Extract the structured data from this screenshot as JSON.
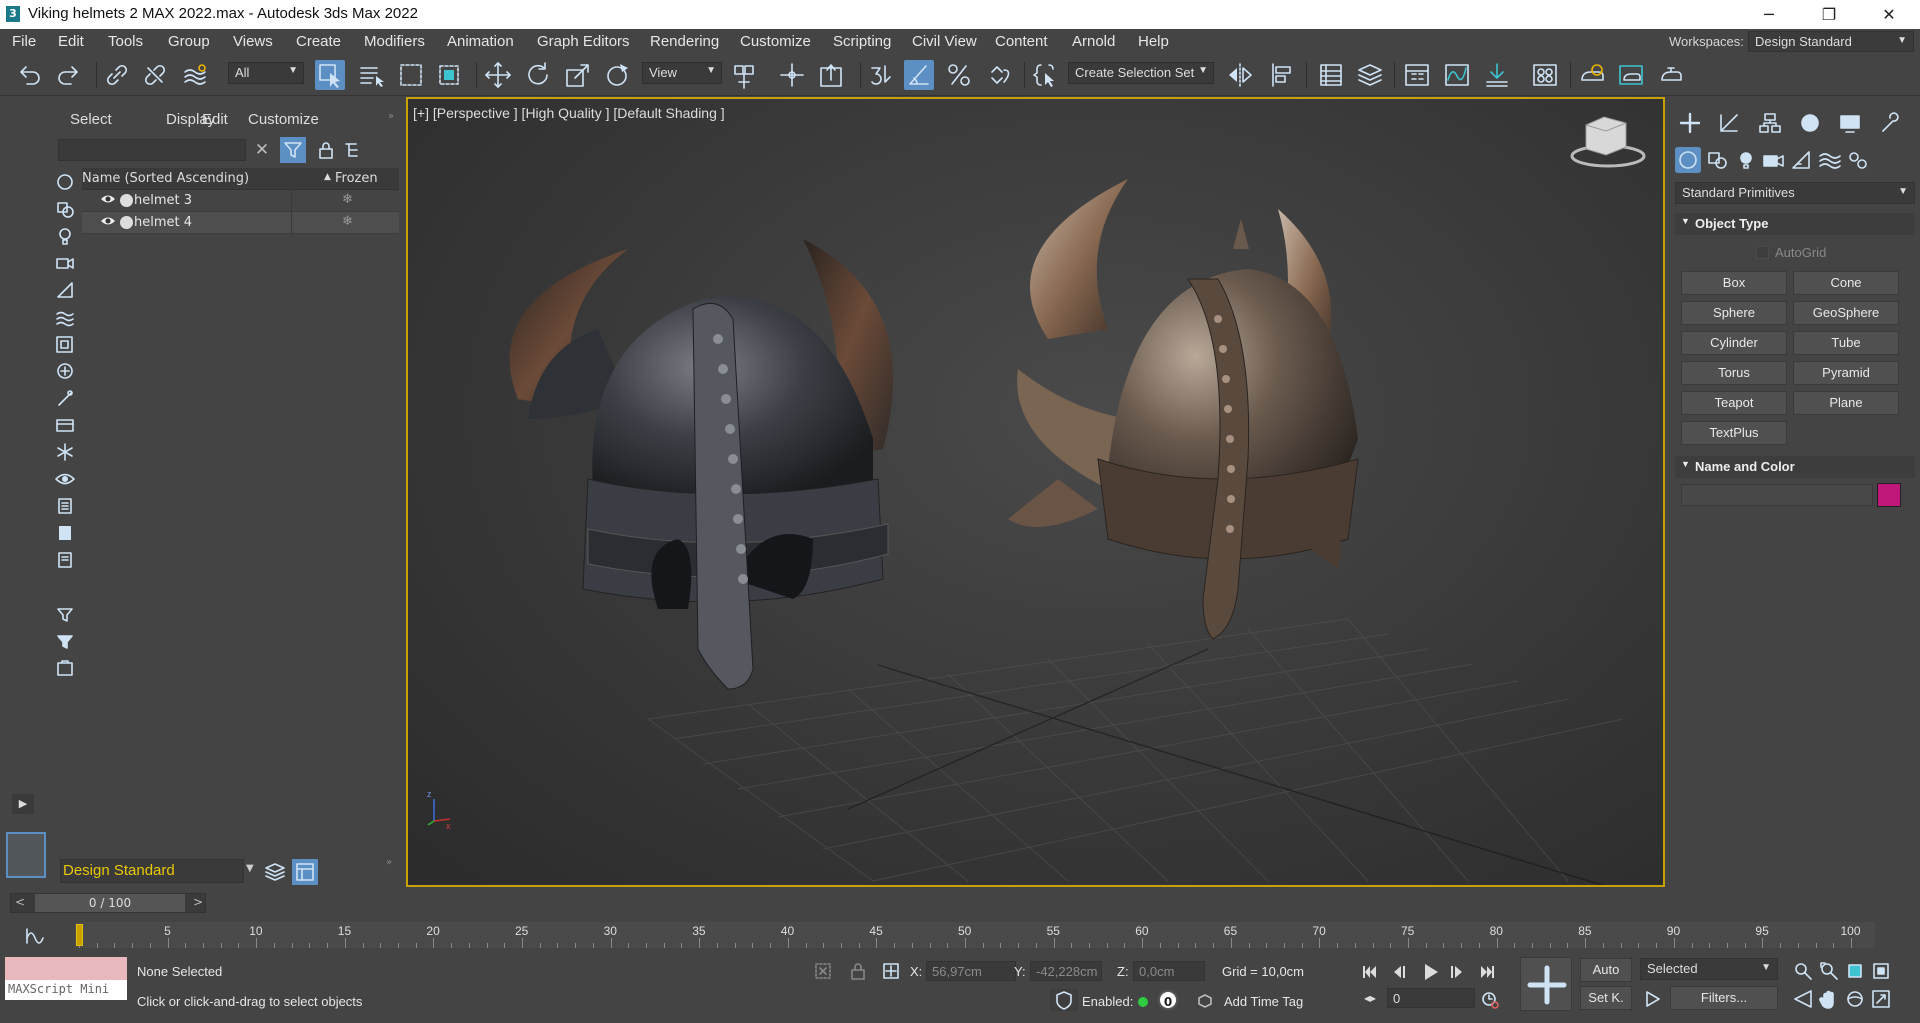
{
  "window": {
    "title": "Viking helmets 2 MAX 2022.max - Autodesk 3ds Max 2022",
    "minimize": "─",
    "maximize": "❐",
    "close": "✕"
  },
  "menu": {
    "items": [
      "File",
      "Edit",
      "Tools",
      "Group",
      "Views",
      "Create",
      "Modifiers",
      "Animation",
      "Graph Editors",
      "Rendering",
      "Customize",
      "Scripting",
      "Civil View",
      "Content",
      "Arnold",
      "Help"
    ],
    "workspaces_label": "Workspaces:",
    "workspace_value": "Design Standard"
  },
  "toolbar": {
    "selection_filter": "All",
    "ref_coord": "View",
    "selection_set_placeholder": "Create Selection Set"
  },
  "scene_explorer": {
    "tabs": [
      "Select",
      "Display",
      "Edit",
      "Customize"
    ],
    "columns": {
      "name": "Name (Sorted Ascending)",
      "frozen": "Frozen"
    },
    "rows": [
      {
        "name": "helmet 3",
        "selected": false
      },
      {
        "name": "helmet 4",
        "selected": true
      }
    ],
    "workspace_bottom": "Design Standard"
  },
  "viewport": {
    "label": "[+] [Perspective ] [High Quality ] [Default Shading ]"
  },
  "command_panel": {
    "category": "Standard Primitives",
    "object_type_header": "Object Type",
    "autogrid": "AutoGrid",
    "buttons": [
      "Box",
      "Cone",
      "Sphere",
      "GeoSphere",
      "Cylinder",
      "Tube",
      "Torus",
      "Pyramid",
      "Teapot",
      "Plane",
      "TextPlus"
    ],
    "name_color_header": "Name and Color",
    "object_color": "#c0187a"
  },
  "timeline": {
    "frame_display": "0 / 100",
    "prev": "<",
    "next": ">",
    "ticks": [
      "5",
      "10",
      "15",
      "20",
      "25",
      "30",
      "35",
      "40",
      "45",
      "50",
      "55",
      "60",
      "65",
      "70",
      "75",
      "80",
      "85",
      "90",
      "95",
      "100"
    ]
  },
  "status": {
    "maxscript": "MAXScript Mini",
    "selection": "None Selected",
    "prompt": "Click or click-and-drag to select objects",
    "x_label": "X:",
    "x_value": "56,97cm",
    "y_label": "Y:",
    "y_value": "-42,228cm",
    "z_label": "Z:",
    "z_value": "0,0cm",
    "grid": "Grid = 10,0cm",
    "enabled_label": "Enabled:",
    "enabled_value": "0",
    "add_time_tag": "Add Time Tag",
    "auto_button": "Auto",
    "setk_button": "Set K.",
    "key_mode": "Selected",
    "filters_button": "Filters...",
    "frame_spinner": "0"
  }
}
